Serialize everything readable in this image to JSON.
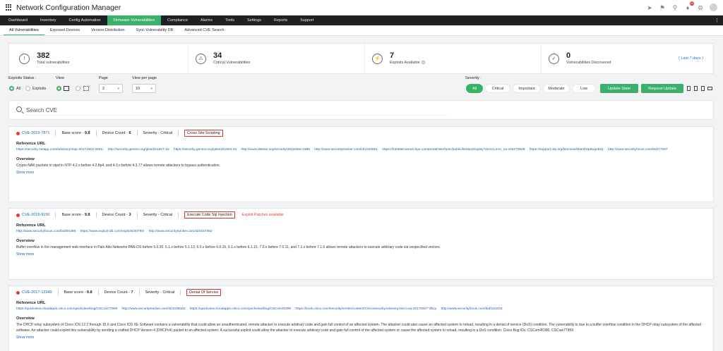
{
  "app": {
    "title": "Network Configuration Manager",
    "notification_count": "10"
  },
  "top_icons": [
    "rocket-icon",
    "megaphone-icon",
    "search-icon",
    "bell-icon",
    "gear-icon",
    "user-icon"
  ],
  "nav": {
    "items": [
      "Dashboard",
      "Inventory",
      "Config Automation",
      "Firmware Vulnerabilities",
      "Compliance",
      "Alarms",
      "Tools",
      "Settings",
      "Reports",
      "Support"
    ],
    "active_index": 3,
    "more": "⋮"
  },
  "subnav": {
    "tabs": [
      "All Vulnerabilities",
      "Exposed Devices",
      "Version Distribution",
      "Sync Vulnerability DB",
      "Advanced CVE Search"
    ],
    "active_index": 0
  },
  "stats": [
    {
      "icon": "warning-icon",
      "value": "382",
      "label": "Total vulnerabilities"
    },
    {
      "icon": "shield-icon",
      "value": "34",
      "label": "Critical Vulnerabilities"
    },
    {
      "icon": "bolt-icon",
      "value": "7",
      "label": "Exploits Available"
    },
    {
      "icon": "shield-icon",
      "value": "0",
      "label": "Vulnerabilities Discovered",
      "link": "( Last 7 days )"
    }
  ],
  "filters": {
    "exploits_status_label": "Exploits Status :",
    "radio_all": "All",
    "radio_exploits": "Exploits",
    "view_label": "View",
    "page_label": "Page",
    "page_value": "2",
    "per_page_label": "View per page",
    "per_page_value": "10",
    "severity_label": "Severity :",
    "severity_options": [
      "All",
      "Critical",
      "Important",
      "Moderate",
      "Low"
    ],
    "severity_active": "All",
    "update_state": "Update State",
    "request_update": "Request Update"
  },
  "search": {
    "placeholder": "Search CVE"
  },
  "labels": {
    "base_score": "Base score - ",
    "device_count": "Device Count - ",
    "severity": "Severity - ",
    "reference_url": "Reference URL",
    "overview": "Overview",
    "show_more": "Show more"
  },
  "cves": [
    {
      "id": "CVE-2015-7871",
      "base_score": "9.8",
      "device_count": "6",
      "severity": "Critical",
      "tag": "Cross Site Scripting",
      "note": "",
      "urls": [
        "https://security.netapp.com/advisory/ntap-20171004-0001/",
        "http://security.gentoo.org/glsa/201607-15",
        "https://security.gentoo.org/glsa/201604-03",
        "http://www.debian.org/security/2015/dsa-3388",
        "http://www.securitytracker.com/id/1033951",
        "https://h20566.www2.hpe.com/portal/site/hpsc/public/kb/docDisplay?docId=emr_na-c05270839",
        "https://support.ntp.org/bin/view/Main/NtpBug2941",
        "http://www.securityfocus.com/bid/77287"
      ],
      "overview": "Crypto-NAK packets in ntpd in NTP 4.2.x before 4.2.8p4, and 4.3.x before 4.3.77 allows remote attackers to bypass authentication."
    },
    {
      "id": "CVE-2016-9150",
      "base_score": "9.8",
      "device_count": "3",
      "severity": "Critical",
      "tag": "Execute Code Sql Injection",
      "note": "Exploit Patches available",
      "urls": [
        "http://www.securityfocus.com/bid/94399",
        "https://www.exploit-db.com/exploits/40790/",
        "http://www.securitytracker.com/id/1037382"
      ],
      "overview": "Buffer overflow in the management web interface in Palo Alto Networks PAN-OS before 5.0.20, 5.1.x before 5.1.13, 6.0.x before 6.0.15, 6.1.x before 6.1.15, 7.0.x before 7.0.11, and 7.1.x before 7.1.6 allows remote attackers to execute arbitrary code via unspecified vectors."
    },
    {
      "id": "CVE-2017-12240",
      "base_score": "9.8",
      "device_count": "7",
      "severity": "Critical",
      "tag": "Denial Of Service",
      "note": "",
      "urls": [
        "https://quickview.cloudapps.cisco.com/quickview/bug/CSCuw77959",
        "http://www.securitytracker.com/id/1039445",
        "https://quickview.cloudapps.cisco.com/quickview/bug/CSCsm45390",
        "https://tools.cisco.com/security/center/content/CiscoSecurityAdvisory/cisco-sa-20170927-dhcp",
        "http://www.securityfocus.com/bid/101034"
      ],
      "overview": "The DHCP relay subsystem of Cisco IOS 12.2 through 15.6 and Cisco IOS XE Software contains a vulnerability that could allow an unauthenticated, remote attacker to execute arbitrary code and gain full control of an affected system. The attacker could also cause an affected system to reload, resulting in a denial of service (DoS) condition. The vulnerability is due to a buffer overflow condition in the DHCP relay subsystem of the affected software. An attacker could exploit this vulnerability by sending a crafted DHCP Version 4 (DHCPv4) packet to an affected system. A successful exploit could allow the attacker to execute arbitrary code and gain full control of the affected system or cause the affected system to reload, resulting in a DoS condition. Cisco Bug IDs: CSCsm45390, CSCuw77959."
    }
  ]
}
